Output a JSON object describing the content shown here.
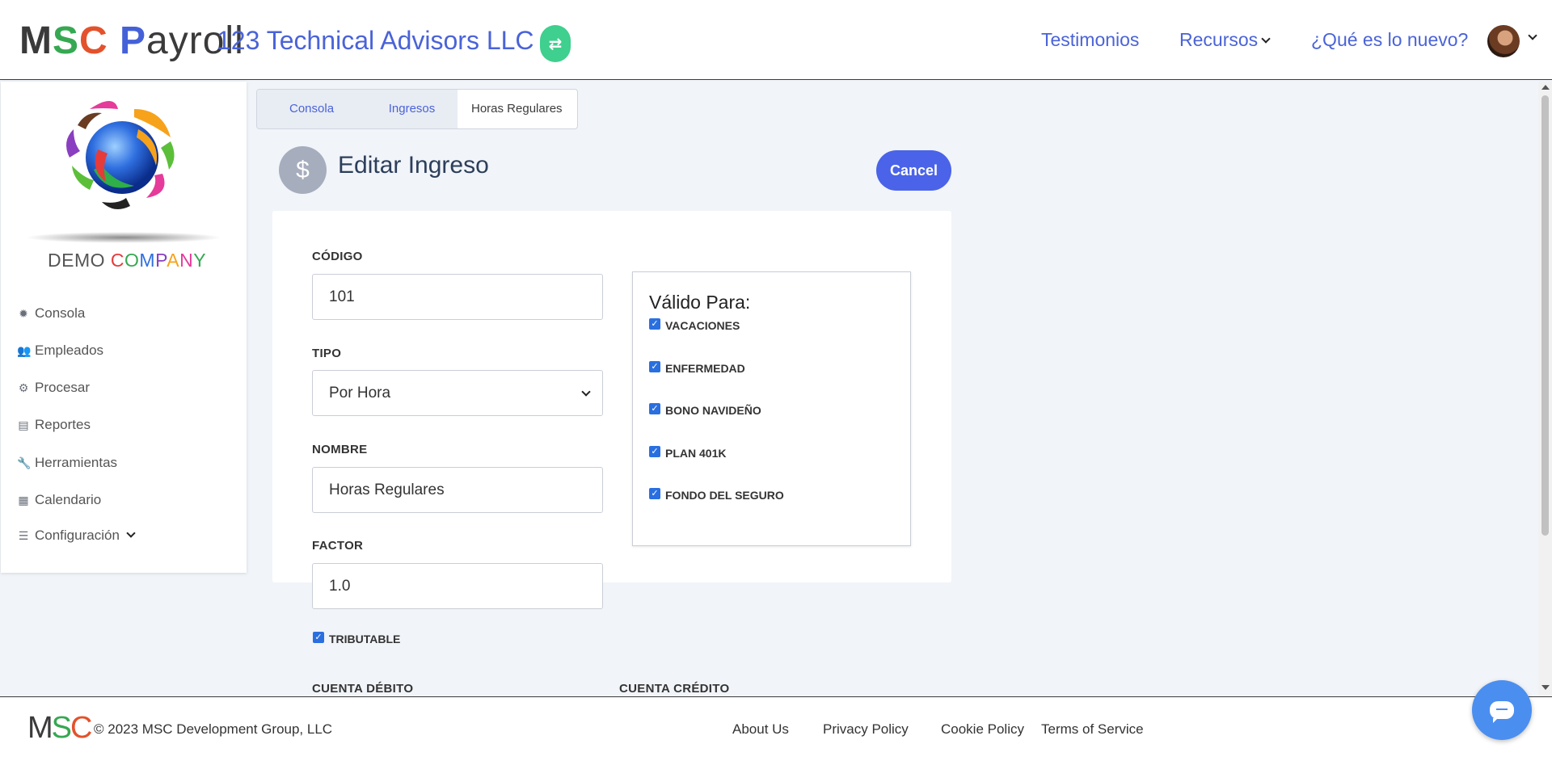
{
  "header": {
    "logo": {
      "m": "M",
      "s": "S",
      "c": "C",
      "space": " ",
      "p": "P",
      "rest": "ayroll"
    },
    "company": "123 Technical Advisors LLC",
    "switch_icon": "swap-arrows-icon",
    "nav": {
      "testimonios": "Testimonios",
      "recursos": "Recursos",
      "nuevo": "¿Qué es lo nuevo?"
    }
  },
  "sidebar": {
    "brand": {
      "demo": "DEMO ",
      "company_letters": [
        "C",
        "O",
        "M",
        "P",
        "A",
        "N",
        "Y"
      ]
    },
    "items": [
      {
        "label": "Consola",
        "icon": "gear-icon"
      },
      {
        "label": "Empleados",
        "icon": "users-icon"
      },
      {
        "label": "Procesar",
        "icon": "cogs-icon"
      },
      {
        "label": "Reportes",
        "icon": "printer-icon"
      },
      {
        "label": "Herramientas",
        "icon": "wrench-icon"
      },
      {
        "label": "Calendario",
        "icon": "calendar-icon"
      },
      {
        "label": "Configuración",
        "icon": "sliders-icon"
      }
    ]
  },
  "breadcrumb": [
    "Consola",
    "Ingresos",
    "Horas Regulares"
  ],
  "page": {
    "icon": "$",
    "title": "Editar Ingreso",
    "cancel": "Cancel"
  },
  "form": {
    "codigo": {
      "label": "CÓDIGO",
      "value": "101"
    },
    "tipo": {
      "label": "TIPO",
      "value": "Por Hora"
    },
    "nombre": {
      "label": "NOMBRE",
      "value": "Horas Regulares"
    },
    "factor": {
      "label": "FACTOR",
      "value": "1.0"
    },
    "tributable": {
      "label": "TRIBUTABLE",
      "checked": true
    },
    "cuenta_debito": "CUENTA DÉBITO",
    "cuenta_credito": "CUENTA CRÉDITO"
  },
  "valid_para": {
    "title": "Válido Para:",
    "options": [
      {
        "label": "VACACIONES",
        "checked": true
      },
      {
        "label": "ENFERMEDAD",
        "checked": true
      },
      {
        "label": "BONO NAVIDEÑO",
        "checked": true
      },
      {
        "label": "PLAN 401K",
        "checked": true
      },
      {
        "label": "FONDO DEL SEGURO",
        "checked": true
      }
    ]
  },
  "footer": {
    "logo": {
      "m": "M",
      "s": "S",
      "c": "C"
    },
    "copyright": "© 2023 MSC Development Group, LLC",
    "links": [
      "About Us",
      "Privacy Policy",
      "Cookie Policy",
      "Terms of Service"
    ]
  },
  "colors": {
    "accent": "#4a63d8",
    "cancel_button": "#4a63e8",
    "switch_button": "#3fcf8e",
    "chat_button": "#4a8ef0"
  }
}
